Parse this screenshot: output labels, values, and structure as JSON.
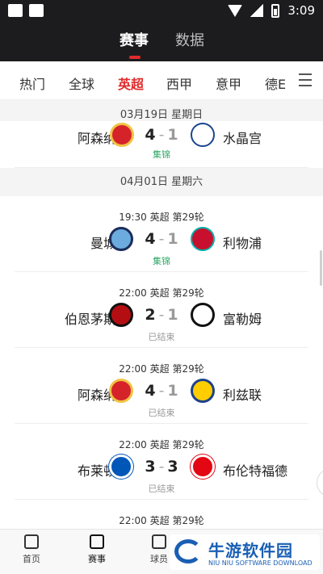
{
  "colors": {
    "accent": "#e02b2b",
    "header_bg": "#1c1c1f",
    "green": "#2fa866",
    "watermark": "#1a5fb4"
  },
  "status_bar": {
    "time": "3:09"
  },
  "top_tabs": [
    "赛事",
    "数据"
  ],
  "league_tabs": [
    "热门",
    "全球",
    "英超",
    "西甲",
    "意甲",
    "德E"
  ],
  "active_league": "英超",
  "sections": [
    {
      "date": "03月19日 星期日"
    },
    {
      "date": "04月01日 星期六"
    }
  ],
  "matches": [
    {
      "time": "",
      "league": "",
      "round": "",
      "home": "阿森纳",
      "home_score": "4",
      "away_score": "1",
      "away": "水晶宫",
      "status": "集锦",
      "home_logo": "arsenal-logo",
      "away_logo": "crystal-palace-logo"
    },
    {
      "time": "19:30",
      "league": "英超",
      "round": "第29轮",
      "home": "曼城",
      "home_score": "4",
      "away_score": "1",
      "away": "利物浦",
      "status": "集锦",
      "home_logo": "man-city-logo",
      "away_logo": "liverpool-logo"
    },
    {
      "time": "22:00",
      "league": "英超",
      "round": "第29轮",
      "home": "伯恩茅斯",
      "home_score": "2",
      "away_score": "1",
      "away": "富勒姆",
      "status": "已结束",
      "home_logo": "bournemouth-logo",
      "away_logo": "fulham-logo"
    },
    {
      "time": "22:00",
      "league": "英超",
      "round": "第29轮",
      "home": "阿森纳",
      "home_score": "4",
      "away_score": "1",
      "away": "利兹联",
      "status": "已结束",
      "home_logo": "arsenal-logo",
      "away_logo": "leeds-logo"
    },
    {
      "time": "22:00",
      "league": "英超",
      "round": "第29轮",
      "home": "布莱顿",
      "home_score": "3",
      "away_score": "3",
      "away": "布伦特福德",
      "status": "已结束",
      "home_logo": "brighton-logo",
      "away_logo": "brentford-logo"
    },
    {
      "time": "22:00",
      "league": "英超",
      "round": "第29轮"
    }
  ],
  "bottom_nav": [
    "首页",
    "赛事",
    "球员"
  ],
  "watermark": {
    "title": "牛游软件园",
    "subtitle": "NIU NIU SOFTWARE DOWNLOAD"
  }
}
